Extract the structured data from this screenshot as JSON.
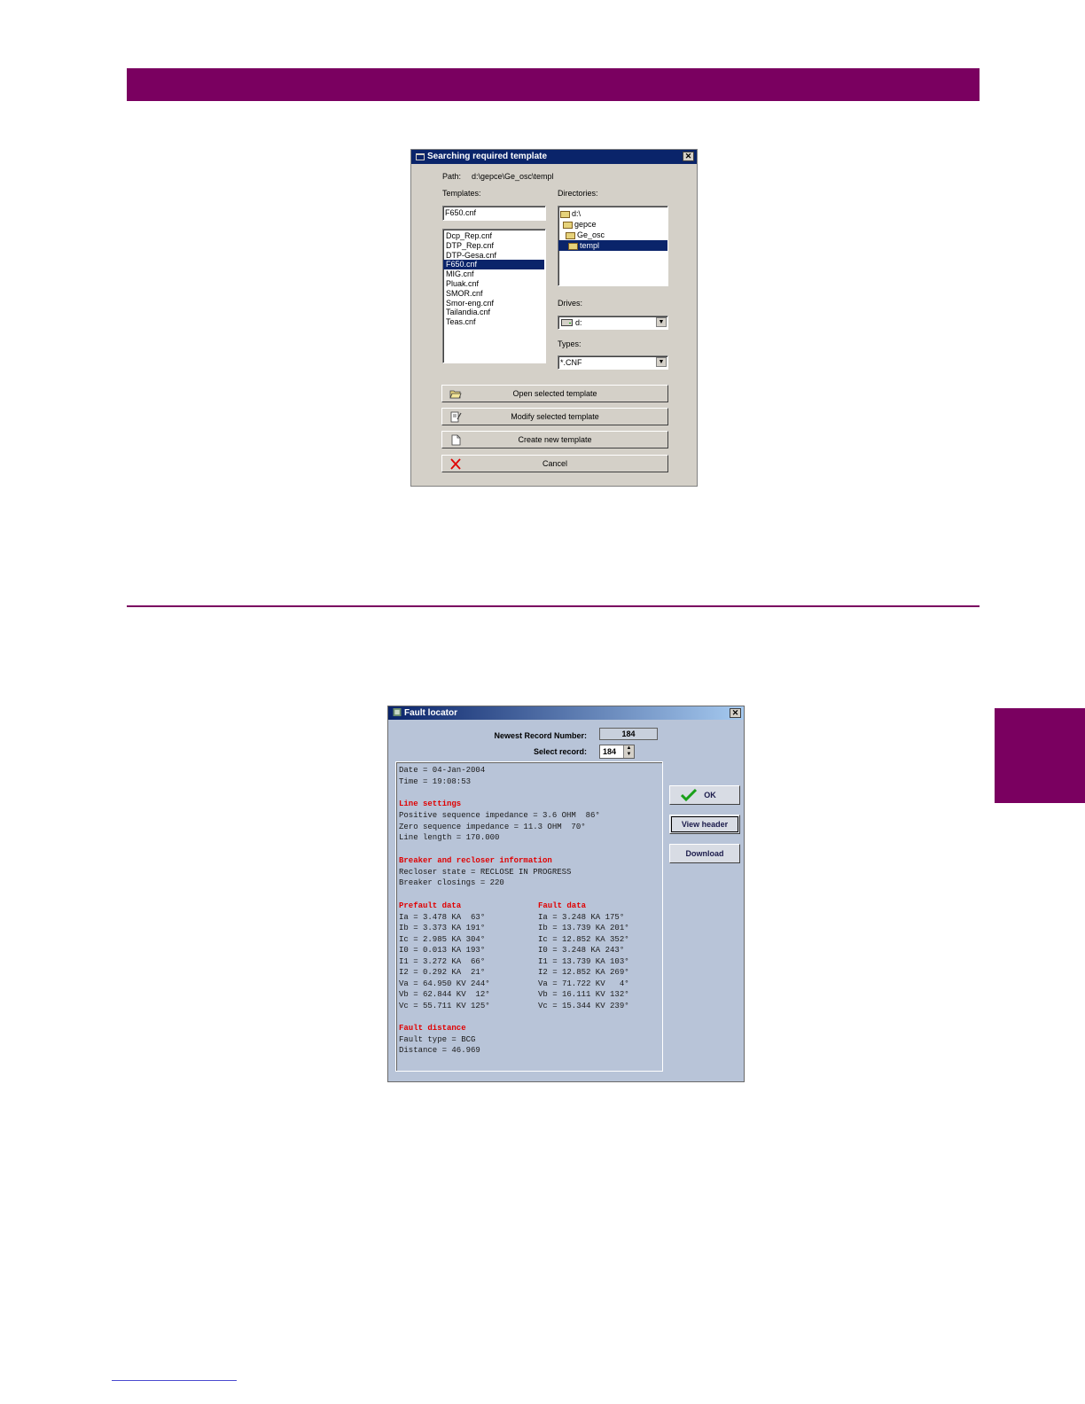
{
  "colors": {
    "accent": "#7a0060",
    "titlebar": "#0a246a",
    "report_heading": "#e00000"
  },
  "template_dialog": {
    "title": "Searching required template",
    "path_label": "Path:",
    "path_value": "d:\\gepce\\Ge_osc\\templ",
    "templates_label": "Templates:",
    "templates_input": "F650.cnf",
    "templates": [
      "Dcp_Rep.cnf",
      "DTP_Rep.cnf",
      "DTP-Gesa.cnf",
      "F650.cnf",
      "MIG.cnf",
      "Pluak.cnf",
      "SMOR.cnf",
      "Smor-eng.cnf",
      "Tailandia.cnf",
      "Teas.cnf"
    ],
    "selected_template_index": 3,
    "directories_label": "Directories:",
    "directories": [
      "d:\\",
      "gepce",
      "Ge_osc",
      "templ"
    ],
    "drives_label": "Drives:",
    "drive_value": "d:",
    "types_label": "Types:",
    "type_value": "*.CNF",
    "buttons": {
      "open": "Open selected template",
      "modify": "Modify selected template",
      "create": "Create new template",
      "cancel": "Cancel"
    }
  },
  "fault_dialog": {
    "title": "Fault locator",
    "newest_record_label": "Newest Record Number:",
    "newest_record_value": "184",
    "select_record_label": "Select record:",
    "select_record_value": "184",
    "buttons": {
      "ok": "OK",
      "view_header": "View header",
      "download": "Download"
    },
    "report": {
      "date": "Date = 04-Jan-2004",
      "time": "Time = 19:08:53",
      "line_settings_heading": "Line settings",
      "line_settings": [
        "Positive sequence impedance = 3.6 OHM  86°",
        "Zero sequence impedance = 11.3 OHM  70°",
        "Line length = 170.000"
      ],
      "breaker_heading": "Breaker and recloser information",
      "breaker": [
        "Recloser state = RECLOSE IN PROGRESS",
        "Breaker closings = 220"
      ],
      "prefault_heading": "Prefault data",
      "prefault": [
        "Ia = 3.478 KA  63°",
        "Ib = 3.373 KA 191°",
        "Ic = 2.985 KA 304°",
        "I0 = 0.013 KA 193°",
        "I1 = 3.272 KA  66°",
        "I2 = 0.292 KA  21°",
        "Va = 64.950 KV 244°",
        "Vb = 62.844 KV  12°",
        "Vc = 55.711 KV 125°"
      ],
      "fault_heading": "Fault data",
      "fault": [
        "Ia = 3.248 KA 175°",
        "Ib = 13.739 KA 201°",
        "Ic = 12.852 KA 352°",
        "I0 = 3.248 KA 243°",
        "I1 = 13.739 KA 103°",
        "I2 = 12.852 KA 269°",
        "Va = 71.722 KV   4°",
        "Vb = 16.111 KV 132°",
        "Vc = 15.344 KV 239°"
      ],
      "distance_heading": "Fault distance",
      "distance": [
        "Fault type = BCG",
        "Distance = 46.969"
      ]
    }
  }
}
